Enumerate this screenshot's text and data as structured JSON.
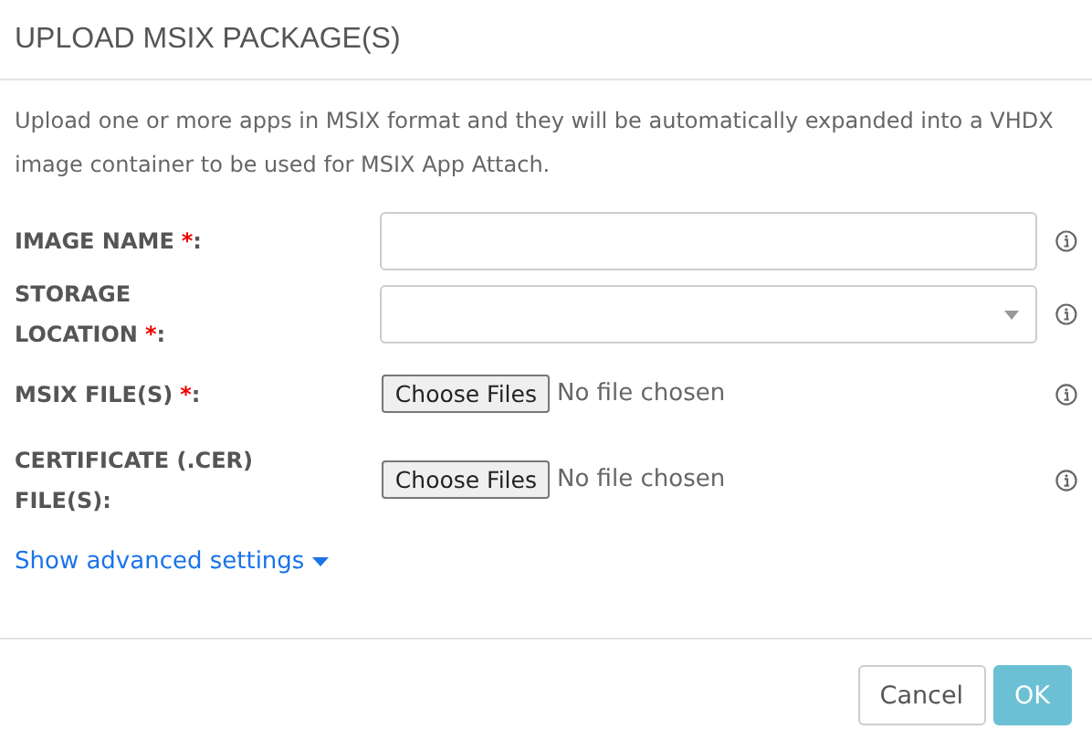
{
  "dialog": {
    "title": "UPLOAD MSIX PACKAGE(S)"
  },
  "description": "Upload one or more apps in MSIX format and they will be automatically expanded into a VHDX image container to be used for MSIX App Attach.",
  "fields": [
    {
      "kind": "text",
      "label": "IMAGE NAME",
      "required_mark": "*",
      "separator": ":"
    },
    {
      "kind": "select",
      "label": "STORAGE LOCATION",
      "required_mark": "*",
      "separator": ":"
    },
    {
      "kind": "file",
      "label": "MSIX FILE(S)",
      "required_mark": "*",
      "separator": ":",
      "button": "Choose Files",
      "status": "No file chosen"
    },
    {
      "kind": "file",
      "label": "CERTIFICATE (.CER) FILE(S):",
      "button": "Choose Files",
      "status": "No file chosen"
    }
  ],
  "advanced_link": "Show advanced settings",
  "buttons": [
    {
      "label": "Cancel",
      "kind": "secondary",
      "disabled": false
    },
    {
      "label": "OK",
      "kind": "primary",
      "disabled": true
    }
  ]
}
